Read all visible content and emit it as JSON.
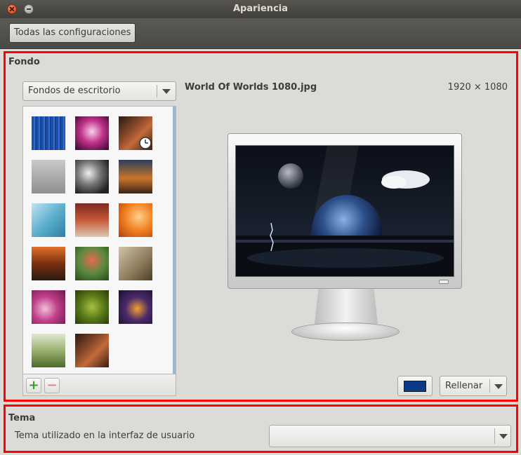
{
  "window": {
    "title": "Apariencia"
  },
  "toolbar": {
    "all_settings_label": "Todas las configuraciones"
  },
  "background_section": {
    "title": "Fondo",
    "source_combo": {
      "selected": "Fondos de escritorio"
    },
    "wallpaper_name": "World Of Worlds 1080.jpg",
    "wallpaper_resolution": "1920 × 1080",
    "color_swatch": "#0b3a86",
    "fill_mode_combo": {
      "selected": "Rellenar"
    },
    "thumbnails_count": 17
  },
  "theme_section": {
    "title": "Tema",
    "label": "Tema utilizado en la interfaz de usuario",
    "theme_combo": {
      "selected": ""
    }
  },
  "highlight_color": "#ff0000"
}
